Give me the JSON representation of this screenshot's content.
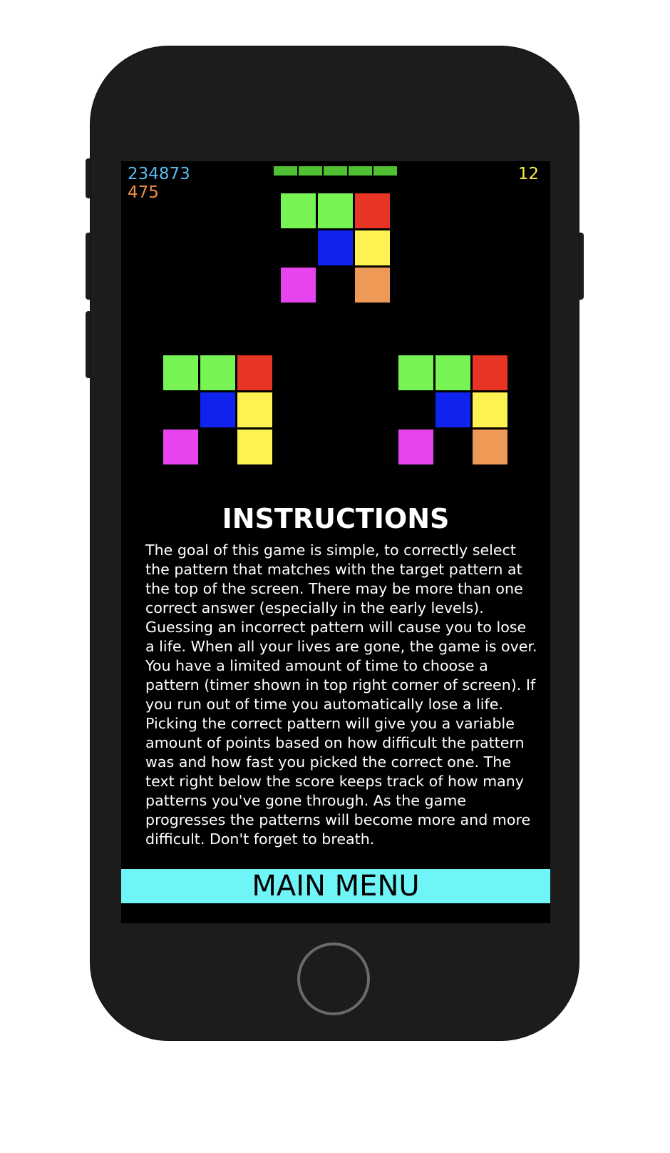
{
  "hud": {
    "score": "234873",
    "patterns_count": "475",
    "timer": "12",
    "lives_remaining": 5,
    "score_color": "#5ab9ec",
    "count_color": "#ef8f43",
    "timer_color": "#f6ef47",
    "life_color": "#4fc133"
  },
  "palette": {
    "green": "#77f354",
    "red": "#e83425",
    "blue": "#0f22ee",
    "yellow": "#fef253",
    "magenta": "#e744f0",
    "orange": "#ef9956",
    "empty": "#000000"
  },
  "target_pattern": [
    "green",
    "green",
    "red",
    "empty",
    "blue",
    "yellow",
    "magenta",
    "empty",
    "orange"
  ],
  "options": [
    {
      "cells": [
        "green",
        "green",
        "red",
        "empty",
        "blue",
        "yellow",
        "magenta",
        "empty",
        "yellow"
      ]
    },
    {
      "cells": [
        "green",
        "green",
        "red",
        "empty",
        "blue",
        "yellow",
        "magenta",
        "empty",
        "orange"
      ]
    }
  ],
  "instructions": {
    "title": "INSTRUCTIONS",
    "body": "The goal of this game is simple, to correctly select the pattern that matches with the target pattern at the top of the screen. There may be more than one correct answer (especially in the early levels). Guessing an incorrect pattern will cause you to lose a life. When all your lives are gone, the game is over. You have a limited amount of time to choose a pattern (timer shown in top right corner of screen). If you run out of time you automatically lose a life. Picking the correct pattern will give you a variable amount of points based on how difficult the pattern was and how fast you picked the correct one. The text right below the score keeps track of how many patterns you've gone through. As the game progresses the patterns will become more and more difficult. Don't forget to breath."
  },
  "main_menu": {
    "label": "MAIN MENU",
    "color": "#6ff5f8"
  }
}
